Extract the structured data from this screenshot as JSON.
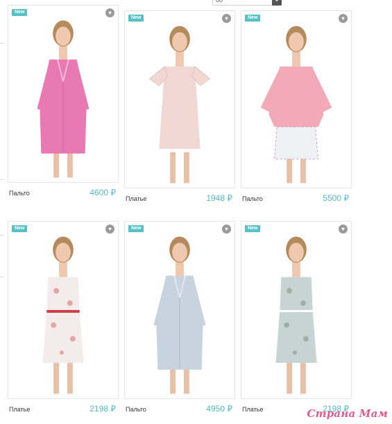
{
  "sort_select": {
    "value": "60"
  },
  "icons": {
    "favorite": "heart-icon",
    "dropdown": "chevron-down-icon"
  },
  "colors": {
    "badge": "#55c1c4",
    "price": "#55b9c7",
    "heart": "#9a9a9a"
  },
  "products": [
    {
      "badge": "New",
      "name": "Пальто",
      "price": "4600 ₽",
      "garment": "coat",
      "color": "#e879b2",
      "skirt": ""
    },
    {
      "badge": "New",
      "name": "Платье",
      "price": "1948 ₽",
      "garment": "dress-ruffle",
      "color": "#f2d8d2",
      "skirt": ""
    },
    {
      "badge": "New",
      "name": "Пальто",
      "price": "5500 ₽",
      "garment": "jacket",
      "color": "#f2aab8",
      "skirt": "#eef0f4"
    },
    {
      "badge": "New",
      "name": "Платье",
      "price": "2198 ₽",
      "garment": "dress-belt",
      "color": "#f4ecea",
      "skirt": ""
    },
    {
      "badge": "New",
      "name": "Пальто",
      "price": "4950 ₽",
      "garment": "coat",
      "color": "#c7d3df",
      "skirt": ""
    },
    {
      "badge": "New",
      "name": "Платье",
      "price": "2198 ₽",
      "garment": "dress-floral",
      "color": "#c7d4d4",
      "skirt": ""
    }
  ],
  "watermark": "Страна Мам"
}
